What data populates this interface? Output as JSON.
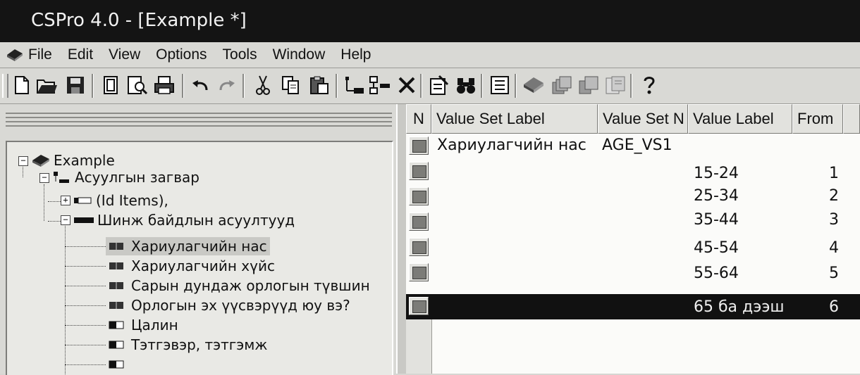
{
  "window": {
    "title": "CSPro 4.0 - [Example *]"
  },
  "menu": {
    "items": [
      "File",
      "Edit",
      "View",
      "Options",
      "Tools",
      "Window",
      "Help"
    ]
  },
  "toolbar": {
    "buttons": [
      {
        "name": "new-file-icon",
        "glyph": "🗋"
      },
      {
        "name": "open-folder-icon",
        "glyph": "📂"
      },
      {
        "name": "save-icon",
        "glyph": "💾"
      },
      {
        "name": "page-icon",
        "glyph": "▯"
      },
      {
        "name": "print-preview-icon",
        "glyph": "🔍"
      },
      {
        "name": "print-icon",
        "glyph": "🖶"
      },
      {
        "name": "undo-icon",
        "glyph": "↶"
      },
      {
        "name": "redo-icon",
        "glyph": "↷"
      },
      {
        "name": "cut-icon",
        "glyph": "✂"
      },
      {
        "name": "copy-icon",
        "glyph": "⧉"
      },
      {
        "name": "paste-icon",
        "glyph": "📋"
      },
      {
        "name": "add-item-icon",
        "glyph": "⊞"
      },
      {
        "name": "insert-item-icon",
        "glyph": "⊟"
      },
      {
        "name": "delete-icon",
        "glyph": "✕"
      },
      {
        "name": "edit-properties-icon",
        "glyph": "✎"
      },
      {
        "name": "find-binoculars-icon",
        "glyph": "👓"
      },
      {
        "name": "layout-icon",
        "glyph": "☰"
      },
      {
        "name": "dictionary-icon",
        "glyph": "📘"
      },
      {
        "name": "cascade-icon",
        "glyph": "❐"
      },
      {
        "name": "tile-icon",
        "glyph": "❑"
      },
      {
        "name": "window-list-icon",
        "glyph": "▤"
      },
      {
        "name": "help-icon",
        "glyph": "?"
      }
    ]
  },
  "tree": {
    "root": "Example",
    "level": "Асуулгын загвар",
    "id_items": "(Id Items),",
    "record": "Шинж байдлын асуултууд",
    "items": [
      "Хариулагчийн нас",
      "Хариулагчийн хүйс",
      "Сарын дундаж орлогын түвшин",
      "Орлогын эх үүсвэрүүд юу вэ?",
      "Цалин",
      "Тэтгэвэр, тэтгэмж"
    ],
    "selected_item": "Хариулагчийн нас"
  },
  "grid": {
    "columns": {
      "n": "N",
      "value_set_label": "Value Set Label",
      "value_set_name": "Value Set N",
      "value_label": "Value Label",
      "from": "From"
    },
    "rows": [
      {
        "value_set_label": "Хариулагчийн нас",
        "value_set_name": "AGE_VS1",
        "value_label": "",
        "from": ""
      },
      {
        "value_set_label": "",
        "value_set_name": "",
        "value_label": "15-24",
        "from": "1"
      },
      {
        "value_set_label": "",
        "value_set_name": "",
        "value_label": "25-34",
        "from": "2"
      },
      {
        "value_set_label": "",
        "value_set_name": "",
        "value_label": "35-44",
        "from": "3"
      },
      {
        "value_set_label": "",
        "value_set_name": "",
        "value_label": "45-54",
        "from": "4"
      },
      {
        "value_set_label": "",
        "value_set_name": "",
        "value_label": "55-64",
        "from": "5"
      },
      {
        "value_set_label": "",
        "value_set_name": "",
        "value_label": "65 ба дээш",
        "from": "6"
      }
    ],
    "selected_row": 6
  },
  "colors": {
    "titlebar": "#141414",
    "chrome": "#d9d9d5",
    "grid_bg": "#fbfbf9",
    "selection": "#111111"
  }
}
